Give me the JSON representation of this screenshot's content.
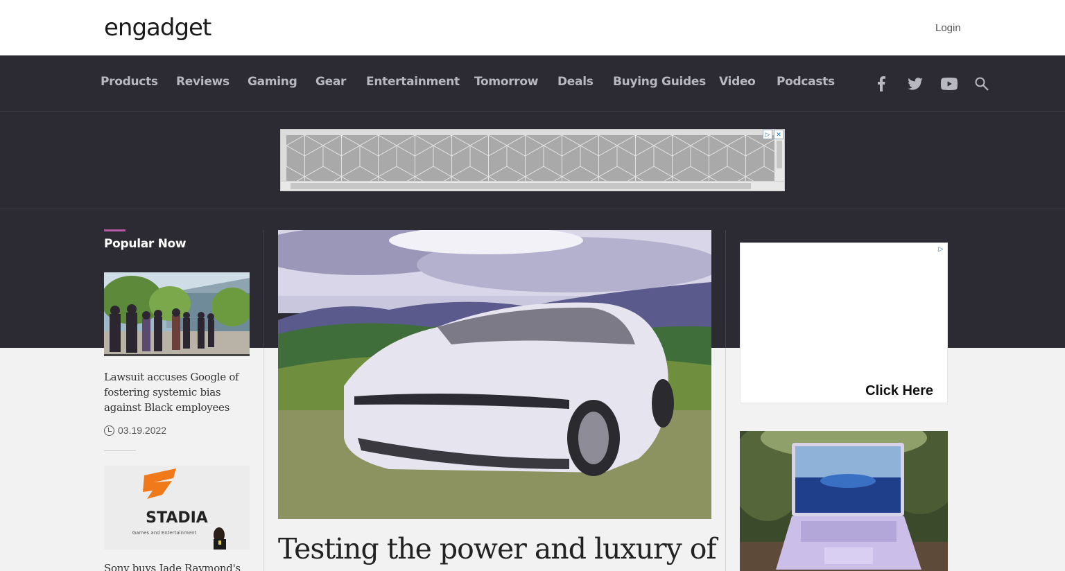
{
  "header": {
    "logo_text": "engadget",
    "login_label": "Login"
  },
  "nav": {
    "items": [
      {
        "label": "Products"
      },
      {
        "label": "Reviews"
      },
      {
        "label": "Gaming"
      },
      {
        "label": "Gear"
      },
      {
        "label": "Entertainment"
      },
      {
        "label": "Tomorrow"
      },
      {
        "label": "Deals"
      },
      {
        "label": "Buying Guides"
      },
      {
        "label": "Video"
      },
      {
        "label": "Podcasts"
      }
    ],
    "icons": [
      "facebook-icon",
      "twitter-icon",
      "youtube-icon",
      "search-icon"
    ]
  },
  "sidebar": {
    "section_title": "Popular Now",
    "stories": [
      {
        "title": "Lawsuit accuses Google of fostering systemic bias against Black employees",
        "date": "03.19.2022"
      },
      {
        "title": "Sony buys Jade Raymond's",
        "date": ""
      }
    ],
    "stadia_logo": "STADIA",
    "stadia_tagline": "Games and Entertainment"
  },
  "hero": {
    "headline": "Testing the power and luxury of"
  },
  "right_ad": {
    "cta": "Click Here"
  },
  "colors": {
    "dark_band": "#2c2b33",
    "accent": "#b45aa3",
    "nav_text": "#b8b8bf"
  }
}
